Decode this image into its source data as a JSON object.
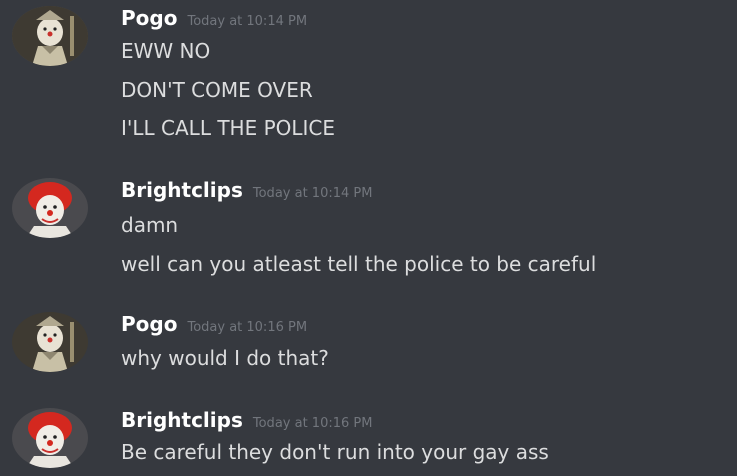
{
  "messages": [
    {
      "author": "Pogo",
      "timestamp": "Today at 10:14 PM",
      "avatar_icon": "clown-portrait-avatar",
      "lines": [
        "EWW NO",
        "DON'T COME OVER",
        "I'LL CALL THE POLICE"
      ]
    },
    {
      "author": "Brightclips",
      "timestamp": "Today at 10:14 PM",
      "avatar_icon": "red-hair-clown-avatar",
      "lines": [
        "damn",
        "well can you atleast tell the police to be careful"
      ]
    },
    {
      "author": "Pogo",
      "timestamp": "Today at 10:16 PM",
      "avatar_icon": "clown-portrait-avatar",
      "lines": [
        "why would I do that?"
      ]
    },
    {
      "author": "Brightclips",
      "timestamp": "Today at 10:16 PM",
      "avatar_icon": "red-hair-clown-avatar",
      "lines": [
        "Be careful they don't run into your gay ass"
      ]
    }
  ],
  "colors": {
    "background": "#36393f",
    "username": "#ffffff",
    "message_text": "#dcddde",
    "timestamp": "#72767d"
  }
}
